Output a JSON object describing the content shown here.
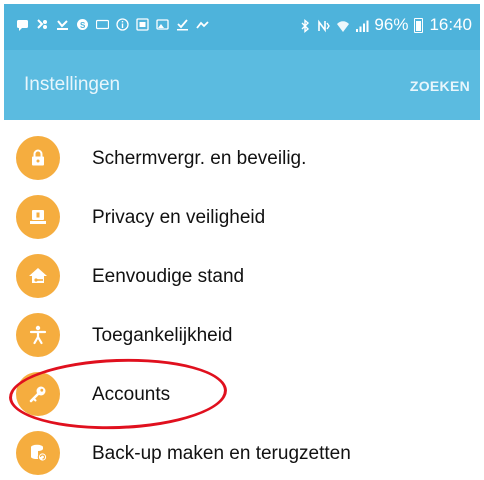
{
  "status_bar": {
    "battery_percent": "96%",
    "time": "16:40",
    "icons_left": [
      "message-icon",
      "wifi-calling-icon",
      "missed-call-icon",
      "skype-icon",
      "card-icon",
      "info-icon",
      "gallery-icon",
      "image-icon",
      "download-icon",
      "mute-icon"
    ],
    "icons_right": [
      "bluetooth-icon",
      "nfc-icon",
      "wifi-icon",
      "signal-icon",
      "battery-icon"
    ]
  },
  "app_bar": {
    "title": "Instellingen",
    "search_label": "ZOEKEN"
  },
  "settings": {
    "items": [
      {
        "label": "Schermvergr. en beveilig.",
        "icon": "lock-icon"
      },
      {
        "label": "Privacy en veiligheid",
        "icon": "privacy-icon"
      },
      {
        "label": "Eenvoudige stand",
        "icon": "easy-mode-icon"
      },
      {
        "label": "Toegankelijkheid",
        "icon": "accessibility-icon"
      },
      {
        "label": "Accounts",
        "icon": "key-icon"
      },
      {
        "label": "Back-up maken en terugzetten",
        "icon": "backup-icon"
      }
    ]
  },
  "colors": {
    "status_bar": "#4eb3db",
    "app_bar": "#5bbbe0",
    "icon_circle": "#f5ad3f",
    "highlight": "#e0101e"
  }
}
